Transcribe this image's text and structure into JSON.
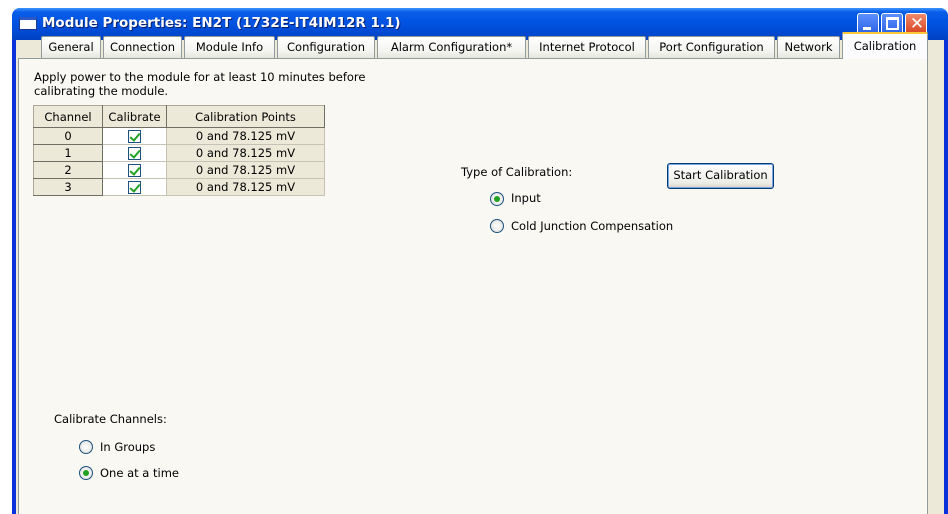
{
  "window": {
    "title": "Module Properties: EN2T (1732E-IT4IM12R 1.1)"
  },
  "tabs": [
    {
      "label": "General"
    },
    {
      "label": "Connection"
    },
    {
      "label": "Module Info"
    },
    {
      "label": "Configuration"
    },
    {
      "label": "Alarm Configuration*"
    },
    {
      "label": "Internet Protocol"
    },
    {
      "label": "Port Configuration"
    },
    {
      "label": "Network"
    },
    {
      "label": "Calibration"
    }
  ],
  "active_tab": "Calibration",
  "calibration": {
    "notice_line1": "Apply power to the module for at least 10 minutes before",
    "notice_line2": "calibrating the module.",
    "table": {
      "headers": [
        "Channel",
        "Calibrate",
        "Calibration Points"
      ],
      "rows": [
        {
          "channel": "0",
          "calibrate": true,
          "points": "0 and 78.125 mV"
        },
        {
          "channel": "1",
          "calibrate": true,
          "points": "0 and 78.125 mV"
        },
        {
          "channel": "2",
          "calibrate": true,
          "points": "0 and 78.125 mV"
        },
        {
          "channel": "3",
          "calibrate": true,
          "points": "0 and 78.125 mV"
        }
      ]
    },
    "type_label": "Type of Calibration:",
    "type_options": [
      {
        "label": "Input",
        "selected": true
      },
      {
        "label": "Cold Junction Compensation",
        "selected": false
      }
    ],
    "start_button": "Start Calibration",
    "channels_label": "Calibrate Channels:",
    "channels_options": [
      {
        "label": "In Groups",
        "selected": false
      },
      {
        "label": "One at a time",
        "selected": true
      }
    ]
  }
}
